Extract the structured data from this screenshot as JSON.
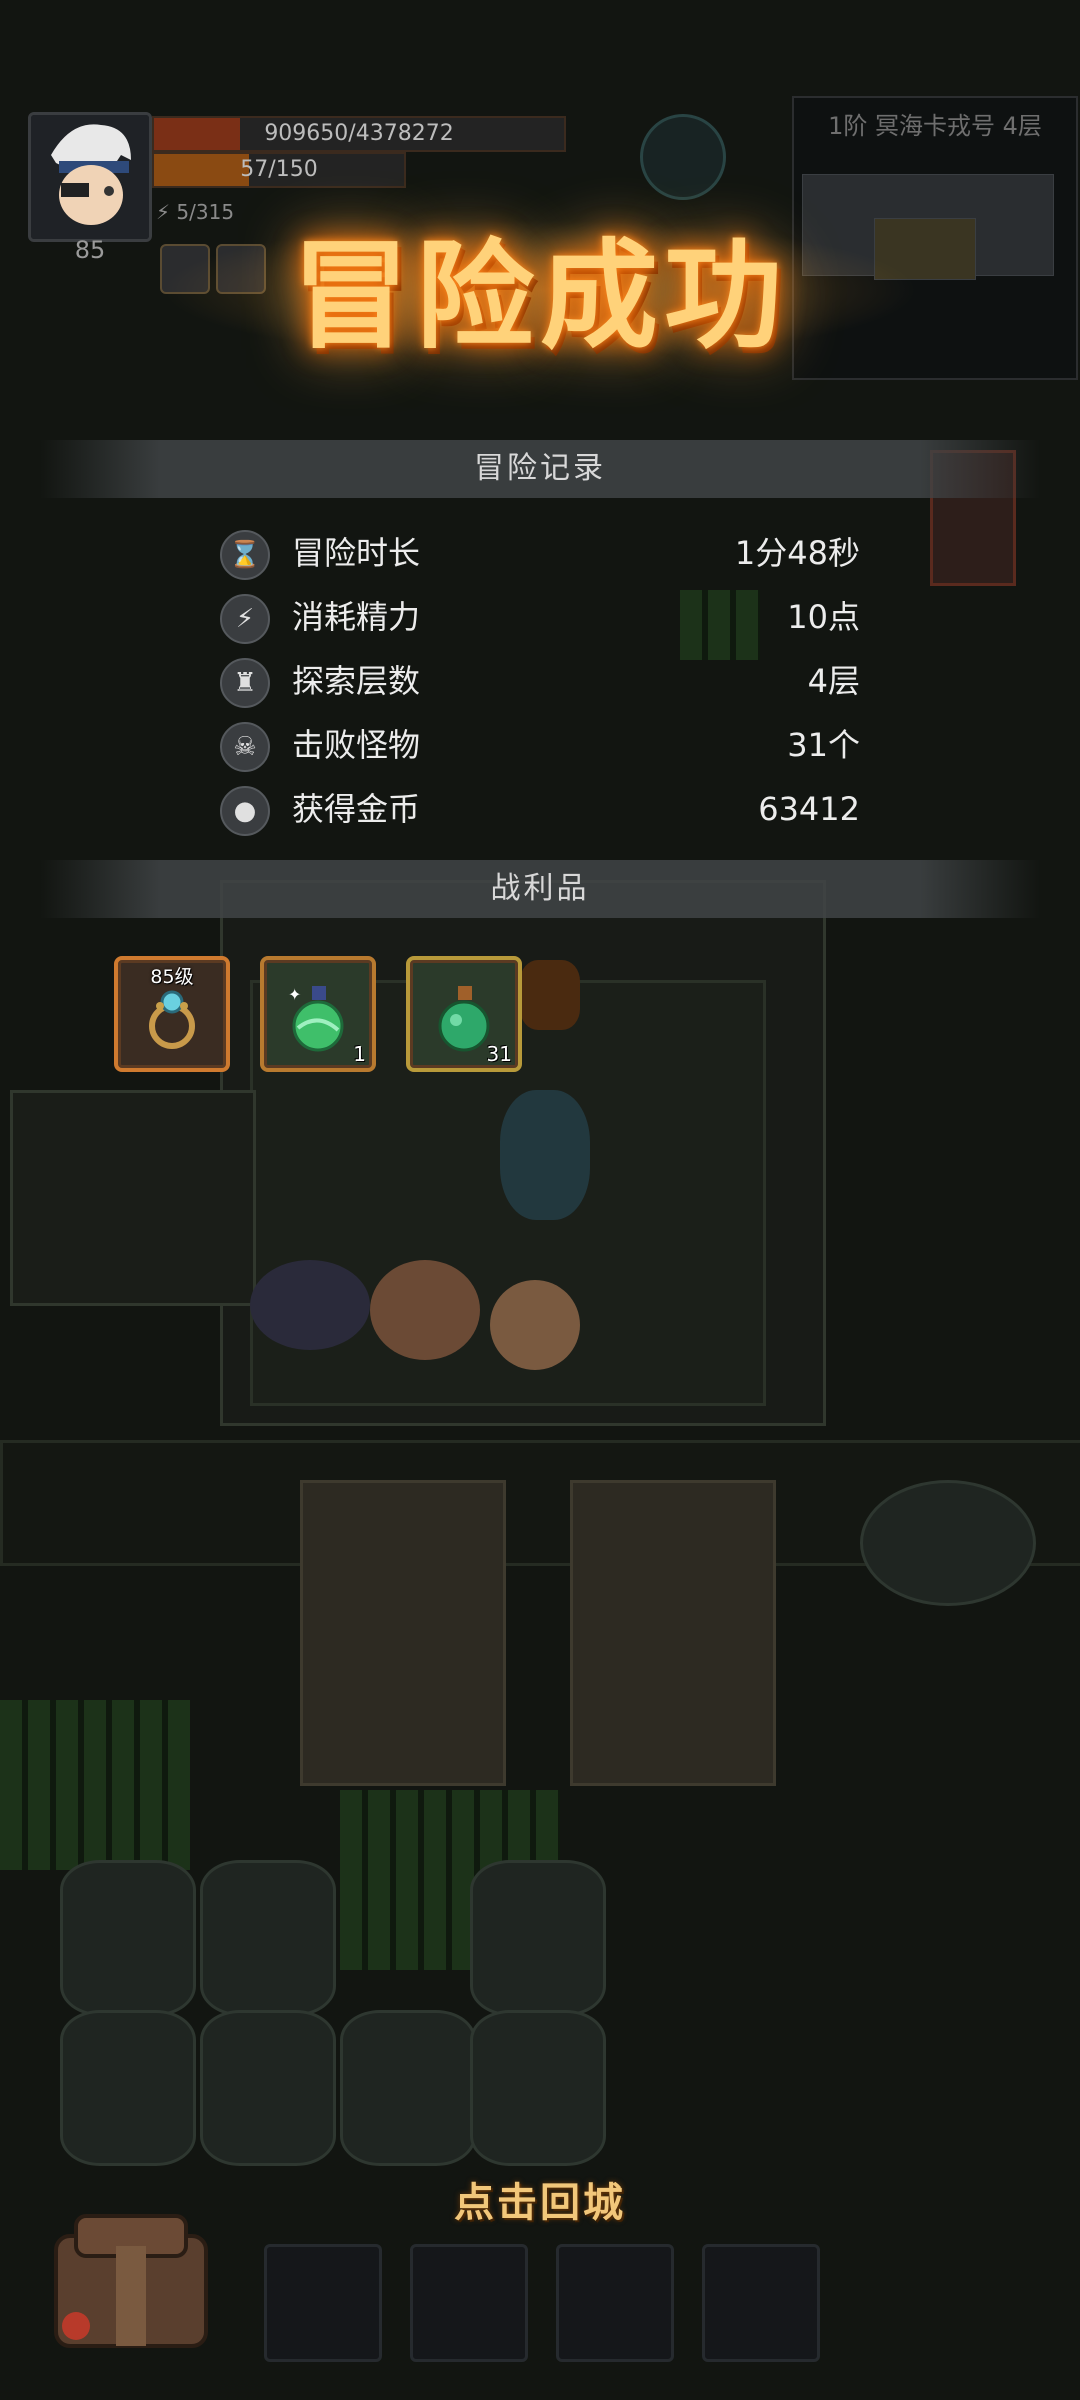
{
  "hud": {
    "level": "85",
    "hp_text": "909650/4378272",
    "hp_fraction": 0.21,
    "exp_text": "57/150",
    "exp_fraction": 0.38,
    "energy_text": "5/315",
    "energy_icon": "lightning-icon"
  },
  "minimap": {
    "title": "1阶 冥海卡戎号 4层"
  },
  "banner": {
    "title": "冒险成功"
  },
  "record": {
    "header": "冒险记录",
    "rows": [
      {
        "icon": "hourglass-icon",
        "glyph": "⌛",
        "label": "冒险时长",
        "value": "1分48秒"
      },
      {
        "icon": "lightning-icon",
        "glyph": "⚡",
        "label": "消耗精力",
        "value": "10点"
      },
      {
        "icon": "tower-icon",
        "glyph": "♜",
        "label": "探索层数",
        "value": "4层"
      },
      {
        "icon": "skull-icon",
        "glyph": "☠",
        "label": "击败怪物",
        "value": "31个"
      },
      {
        "icon": "coin-icon",
        "glyph": "●",
        "label": "获得金币",
        "value": "63412"
      }
    ]
  },
  "loot": {
    "header": "战利品",
    "items": [
      {
        "icon": "ring-icon",
        "top_label": "85级",
        "count": ""
      },
      {
        "icon": "green-potion-icon",
        "top_label": "",
        "count": "1"
      },
      {
        "icon": "round-flask-icon",
        "top_label": "",
        "count": "31"
      }
    ]
  },
  "footer": {
    "return_label": "点击回城"
  },
  "colors": {
    "accent_gold": "#f2c77a",
    "title_glow": "#ff8a1f",
    "hp_bar": "#7a2f16",
    "exp_bar": "#8a4a12"
  }
}
